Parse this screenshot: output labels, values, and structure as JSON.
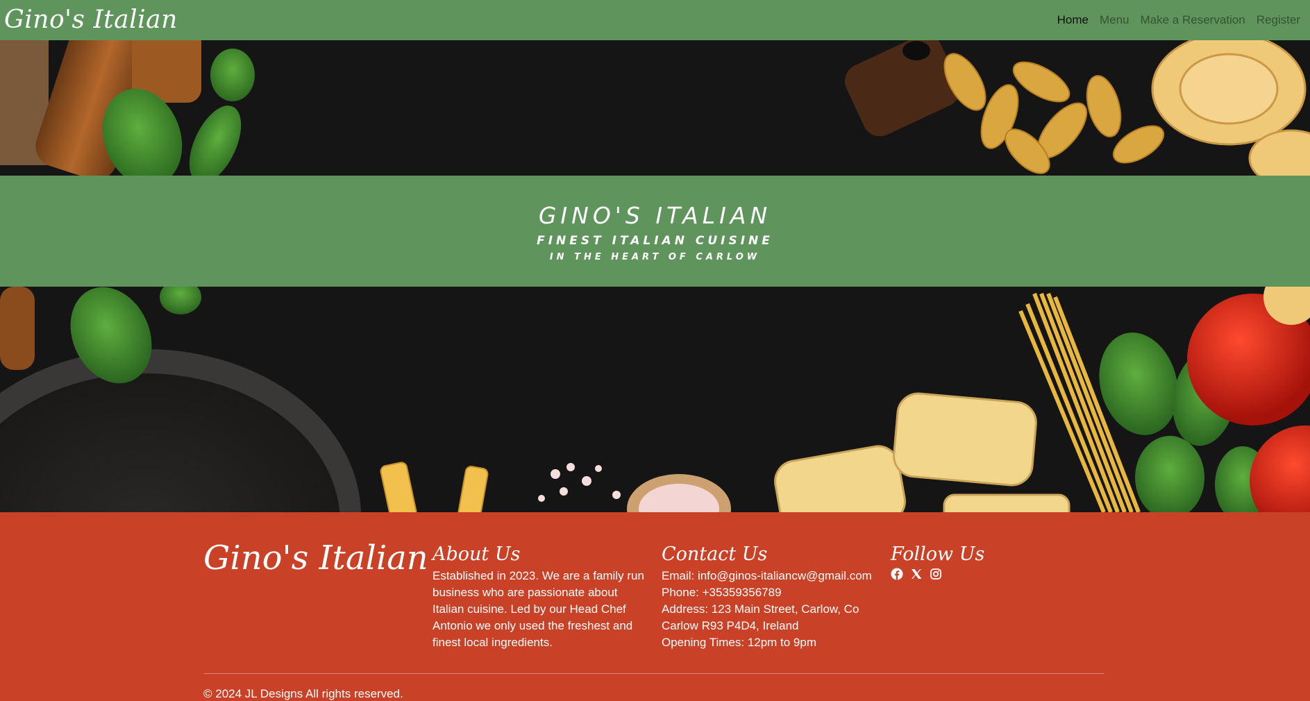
{
  "brand": "Gino's Italian",
  "nav": {
    "items": [
      {
        "label": "Home",
        "active": true
      },
      {
        "label": "Menu",
        "active": false
      },
      {
        "label": "Make a Reservation",
        "active": false
      },
      {
        "label": "Register",
        "active": false
      }
    ]
  },
  "banner": {
    "title": "GINO'S ITALIAN",
    "subtitle": "FINEST ITALIAN CUISINE",
    "tagline": "IN THE HEART OF CARLOW"
  },
  "footer": {
    "brand": "Gino's Italian",
    "about": {
      "heading": "About Us",
      "text": "Established in 2023. We are a family run business who are passionate about Italian cuisine. Led by our Head Chef Antonio we only used the freshest and finest local ingredients."
    },
    "contact": {
      "heading": "Contact Us",
      "email": "Email: info@ginos-italiancw@gmail.com",
      "phone": "Phone: +35359356789",
      "address": "Address: 123 Main Street, Carlow, Co Carlow R93 P4D4, Ireland",
      "hours": "Opening Times: 12pm to 9pm"
    },
    "follow": {
      "heading": "Follow Us",
      "icons": [
        "facebook-icon",
        "x-twitter-icon",
        "instagram-icon"
      ]
    },
    "copyright": "© 2024 JL Designs All rights reserved."
  },
  "colors": {
    "green": "#5f955c",
    "red": "#c94126",
    "dark": "#141414"
  }
}
